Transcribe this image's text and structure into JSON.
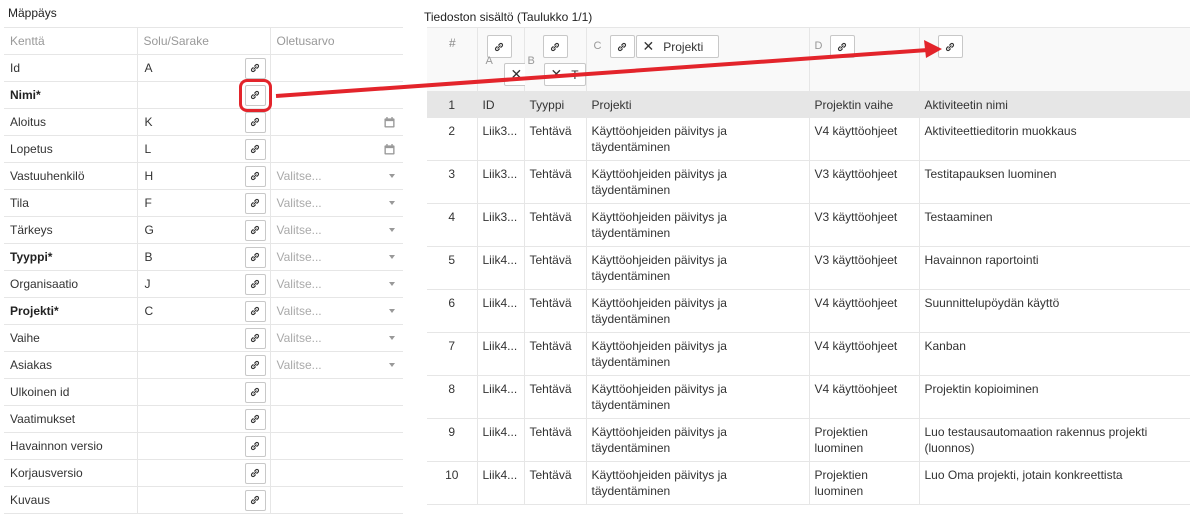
{
  "left_panel": {
    "title": "Mäppäys",
    "columns": [
      "Kenttä",
      "Solu/Sarake",
      "Oletusarvo"
    ],
    "rows": [
      {
        "field": "Id",
        "required": false,
        "cell": "A",
        "default_type": "none",
        "default_text": ""
      },
      {
        "field": "Nimi*",
        "required": true,
        "cell": "",
        "default_type": "none",
        "default_text": "",
        "highlight": true
      },
      {
        "field": "Aloitus",
        "required": false,
        "cell": "K",
        "default_type": "date",
        "default_text": ""
      },
      {
        "field": "Lopetus",
        "required": false,
        "cell": "L",
        "default_type": "date",
        "default_text": ""
      },
      {
        "field": "Vastuuhenkilö",
        "required": false,
        "cell": "H",
        "default_type": "select",
        "default_text": "Valitse..."
      },
      {
        "field": "Tila",
        "required": false,
        "cell": "F",
        "default_type": "select",
        "default_text": "Valitse..."
      },
      {
        "field": "Tärkeys",
        "required": false,
        "cell": "G",
        "default_type": "select",
        "default_text": "Valitse..."
      },
      {
        "field": "Tyyppi*",
        "required": true,
        "cell": "B",
        "default_type": "select",
        "default_text": "Valitse..."
      },
      {
        "field": "Organisaatio",
        "required": false,
        "cell": "J",
        "default_type": "select",
        "default_text": "Valitse..."
      },
      {
        "field": "Projekti*",
        "required": true,
        "cell": "C",
        "default_type": "select",
        "default_text": "Valitse..."
      },
      {
        "field": "Vaihe",
        "required": false,
        "cell": "",
        "default_type": "select",
        "default_text": "Valitse..."
      },
      {
        "field": "Asiakas",
        "required": false,
        "cell": "",
        "default_type": "select",
        "default_text": "Valitse..."
      },
      {
        "field": "Ulkoinen id",
        "required": false,
        "cell": "",
        "default_type": "none",
        "default_text": ""
      },
      {
        "field": "Vaatimukset",
        "required": false,
        "cell": "",
        "default_type": "none",
        "default_text": ""
      },
      {
        "field": "Havainnon versio",
        "required": false,
        "cell": "",
        "default_type": "none",
        "default_text": ""
      },
      {
        "field": "Korjausversio",
        "required": false,
        "cell": "",
        "default_type": "none",
        "default_text": ""
      },
      {
        "field": "Kuvaus",
        "required": false,
        "cell": "",
        "default_type": "none",
        "default_text": ""
      }
    ]
  },
  "right_panel": {
    "title": "Tiedoston sisältö (Taulukko 1/1)",
    "hash": "#",
    "column_letters": [
      "A",
      "B",
      "C",
      "D"
    ],
    "col_c_tag": "Projekti",
    "col_b_tag": "T",
    "header_row": {
      "num": "1",
      "cells": [
        "ID",
        "Tyyppi",
        "Projekti",
        "Projektin vaihe",
        "Aktiviteetin nimi"
      ]
    },
    "rows": [
      {
        "num": "2",
        "id": "Liik3...",
        "type": "Tehtävä",
        "project": "Käyttöohjeiden päivitys ja täydentäminen",
        "phase": "V4 käyttöohjeet",
        "activity": "Aktiviteettieditorin muokkaus"
      },
      {
        "num": "3",
        "id": "Liik3...",
        "type": "Tehtävä",
        "project": "Käyttöohjeiden päivitys ja täydentäminen",
        "phase": "V3 käyttöohjeet",
        "activity": "Testitapauksen luominen"
      },
      {
        "num": "4",
        "id": "Liik3...",
        "type": "Tehtävä",
        "project": "Käyttöohjeiden päivitys ja täydentäminen",
        "phase": "V3 käyttöohjeet",
        "activity": "Testaaminen"
      },
      {
        "num": "5",
        "id": "Liik4...",
        "type": "Tehtävä",
        "project": "Käyttöohjeiden päivitys ja täydentäminen",
        "phase": "V3 käyttöohjeet",
        "activity": "Havainnon raportointi"
      },
      {
        "num": "6",
        "id": "Liik4...",
        "type": "Tehtävä",
        "project": "Käyttöohjeiden päivitys ja täydentäminen",
        "phase": "V4 käyttöohjeet",
        "activity": "Suunnittelupöydän käyttö"
      },
      {
        "num": "7",
        "id": "Liik4...",
        "type": "Tehtävä",
        "project": "Käyttöohjeiden päivitys ja täydentäminen",
        "phase": "V4 käyttöohjeet",
        "activity": "Kanban"
      },
      {
        "num": "8",
        "id": "Liik4...",
        "type": "Tehtävä",
        "project": "Käyttöohjeiden päivitys ja täydentäminen",
        "phase": "V4 käyttöohjeet",
        "activity": "Projektin kopioiminen"
      },
      {
        "num": "9",
        "id": "Liik4...",
        "type": "Tehtävä",
        "project": "Käyttöohjeiden päivitys ja täydentäminen",
        "phase": "Projektien luominen",
        "activity": "Luo testausautomaation rakennus projekti (luonnos)"
      },
      {
        "num": "10",
        "id": "Liik4...",
        "type": "Tehtävä",
        "project": "Käyttöohjeiden päivitys ja täydentäminen",
        "phase": "Projektien luominen",
        "activity": "Luo Oma projekti, jotain konkreettista"
      }
    ]
  },
  "colors": {
    "arrow": "#e3242b",
    "header_bg": "#e6e6e6",
    "border": "#e6e6e6"
  }
}
